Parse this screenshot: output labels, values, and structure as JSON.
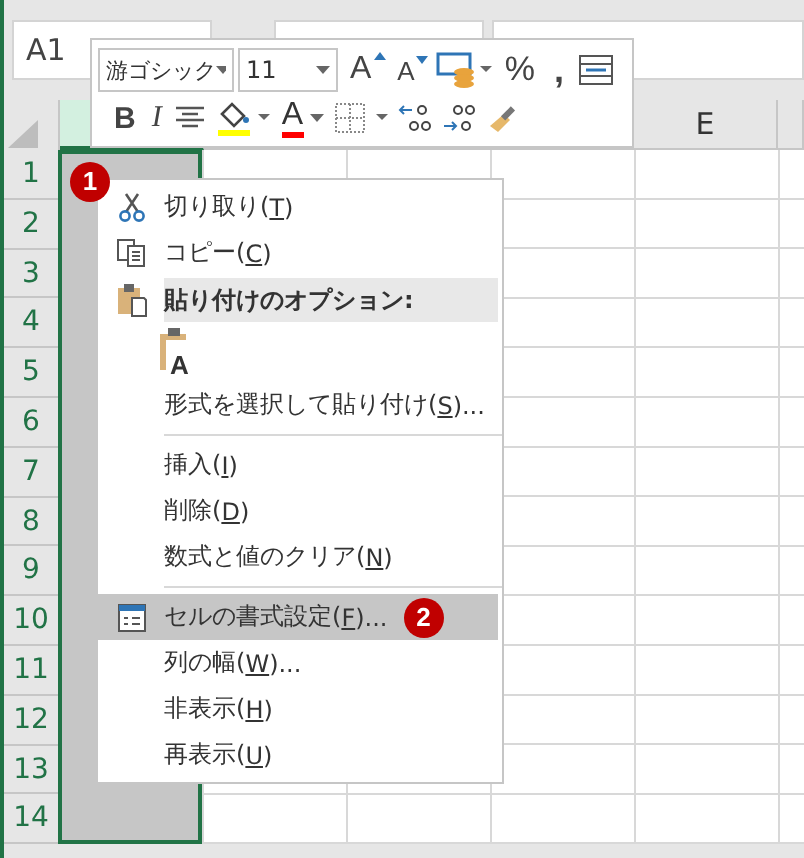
{
  "name_box": "A1",
  "sheet": {
    "columns": [
      {
        "selected": true
      },
      {
        "selected": false
      },
      {
        "selected": false
      },
      {
        "selected": false
      },
      {
        "label": "E",
        "selected": false
      }
    ],
    "rows": [
      "1",
      "2",
      "3",
      "4",
      "5",
      "6",
      "7",
      "8",
      "9",
      "10",
      "11",
      "12",
      "13",
      "14"
    ]
  },
  "mini_toolbar": {
    "font": "游ゴシック",
    "size": "11",
    "row1": [
      {
        "kind": "grow",
        "label": "A"
      },
      {
        "kind": "shrink",
        "label": "A"
      },
      {
        "kind": "currency"
      },
      {
        "kind": "percent",
        "label": "%"
      },
      {
        "kind": "comma",
        "label": ","
      },
      {
        "kind": "wrap"
      }
    ],
    "row2": [
      {
        "kind": "bold",
        "label": "B"
      },
      {
        "kind": "italic",
        "label": "I"
      },
      {
        "kind": "center"
      },
      {
        "kind": "fill"
      },
      {
        "kind": "fontcolor",
        "label": "A"
      },
      {
        "kind": "borders"
      },
      {
        "kind": "incdec"
      },
      {
        "kind": "decdec"
      },
      {
        "kind": "brush"
      }
    ]
  },
  "context_menu": [
    {
      "kind": "cut",
      "before": "切り取り(",
      "key": "T",
      "after": ")",
      "selected": false
    },
    {
      "kind": "copy",
      "before": "コピー(",
      "key": "C",
      "after": ")",
      "selected": false
    },
    {
      "kind": "header",
      "before": "貼り付けのオプション:"
    },
    {
      "kind": "paste",
      "label": "A"
    },
    {
      "kind": "command",
      "before": "形式を選択して貼り付け(",
      "key": "S",
      "after": ")...",
      "selected": false
    },
    {
      "kind": "separator"
    },
    {
      "kind": "command",
      "before": "挿入(",
      "key": "I",
      "after": ")",
      "selected": false
    },
    {
      "kind": "command",
      "before": "削除(",
      "key": "D",
      "after": ")",
      "selected": false
    },
    {
      "kind": "command",
      "before": "数式と値のクリア(",
      "key": "N",
      "after": ")",
      "selected": false
    },
    {
      "kind": "separator"
    },
    {
      "kind": "format",
      "before": "セルの書式設定(",
      "key": "F",
      "after": ")...",
      "selected": true,
      "badge": "2"
    },
    {
      "kind": "command",
      "before": "列の幅(",
      "key": "W",
      "after": ")...",
      "selected": false
    },
    {
      "kind": "command",
      "before": "非表示(",
      "key": "H",
      "after": ")",
      "selected": false
    },
    {
      "kind": "command",
      "before": "再表示(",
      "key": "U",
      "after": ")",
      "selected": false
    }
  ],
  "badge": "1"
}
